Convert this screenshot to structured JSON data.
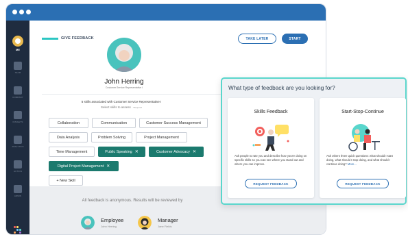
{
  "sidebar": {
    "me_label": "ME",
    "items": [
      {
        "label": "TEAM",
        "icon": "team-icon"
      },
      {
        "label": "COMPANY",
        "icon": "company-icon"
      },
      {
        "label": "INSIGHTS",
        "icon": "insights-icon"
      },
      {
        "label": "ANALYTICS",
        "icon": "analytics-icon"
      },
      {
        "label": "ACTION",
        "icon": "action-icon"
      },
      {
        "label": "ADMIN",
        "icon": "admin-icon"
      }
    ]
  },
  "header": {
    "label": "GIVE FEEDBACK",
    "take_later": "TAKE LATER",
    "start": "START"
  },
  "person": {
    "name": "John Herring",
    "role": "Customer Service Representative I"
  },
  "skills": {
    "count_text": "5 skills associated with Customer Service Representative I",
    "hint": "Select skills to assess",
    "required": "*Required",
    "chips": [
      {
        "label": "Collaboration",
        "selected": false
      },
      {
        "label": "Communication",
        "selected": false
      },
      {
        "label": "Customer Success Management",
        "selected": false
      },
      {
        "label": "Data Analysis",
        "selected": false
      },
      {
        "label": "Problem Solving",
        "selected": false
      },
      {
        "label": "Project Management",
        "selected": false
      },
      {
        "label": "Time Management",
        "selected": false
      },
      {
        "label": "Public Speaking",
        "selected": true
      },
      {
        "label": "Customer Advocacy",
        "selected": true
      },
      {
        "label": "Digital Project Management",
        "selected": true
      },
      {
        "label": "+ New Skill",
        "selected": false
      }
    ],
    "remove_glyph": "✕"
  },
  "footer": {
    "anon_text": "All feedback is anonymous. Results will be reviewed by",
    "employee_title": "Employee",
    "employee_name": "John Herring",
    "manager_title": "Manager",
    "manager_name": "Jane Fields"
  },
  "panel": {
    "title": "What type of feedback are you looking for?",
    "cards": [
      {
        "title": "Skills Feedback",
        "desc": "Ask people to rate you and describe how you're doing on specific skills so you can see where you stand out and where you can improve.",
        "button": "REQUEST FEEDBACK"
      },
      {
        "title": "Start-Stop-Continue",
        "desc": "Ask others three quick questions: what should I start doing, what should I stop doing, and what should I continue doing?",
        "more": "More...",
        "button": "REQUEST FEEDBACK"
      }
    ]
  },
  "colors": {
    "brand_blue": "#2b6fb3",
    "sidebar": "#1f2c3f",
    "teal_selected": "#1b7a6e",
    "panel_border": "#59d6cc"
  }
}
